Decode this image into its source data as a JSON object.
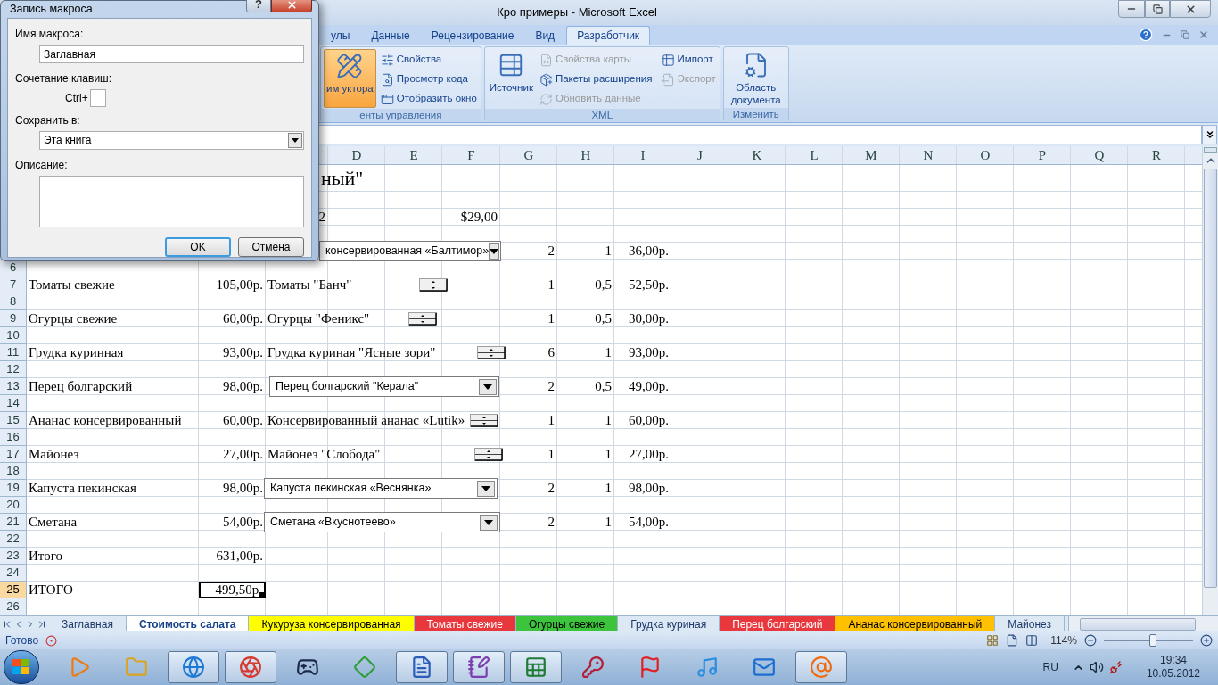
{
  "window": {
    "title": "Кро примеры - Microsoft Excel"
  },
  "ribbon_tabs": [
    {
      "label": "улы",
      "selected": false
    },
    {
      "label": "Данные",
      "selected": false
    },
    {
      "label": "Рецензирование",
      "selected": false
    },
    {
      "label": "Вид",
      "selected": false
    },
    {
      "label": "Разработчик",
      "selected": true
    }
  ],
  "ribbon_groups": [
    {
      "label": "енты управления",
      "items": [
        {
          "kind": "large",
          "label": "им уктора",
          "pressed": true,
          "disabled": false
        },
        {
          "kind": "small",
          "label": "Свойства",
          "pressed": false,
          "disabled": false
        },
        {
          "kind": "small",
          "label": "Просмотр кода",
          "pressed": false,
          "disabled": false
        },
        {
          "kind": "small",
          "label": "Отобразить окно",
          "pressed": false,
          "disabled": false
        }
      ]
    },
    {
      "label": "XML",
      "items": [
        {
          "kind": "large",
          "label": "Источник",
          "pressed": false,
          "disabled": false
        },
        {
          "kind": "small",
          "label": "Свойства карты",
          "pressed": false,
          "disabled": true
        },
        {
          "kind": "small",
          "label": "Пакеты расширения",
          "pressed": false,
          "disabled": false
        },
        {
          "kind": "small",
          "label": "Обновить данные",
          "pressed": false,
          "disabled": true
        },
        {
          "kind": "small",
          "label": "Импорт",
          "pressed": false,
          "disabled": false
        },
        {
          "kind": "small",
          "label": "Экспорт",
          "pressed": false,
          "disabled": true
        }
      ]
    },
    {
      "label": "Изменить",
      "items": [
        {
          "kind": "large",
          "label": "Область документа",
          "pressed": false,
          "disabled": false
        }
      ]
    }
  ],
  "sheet": {
    "columns": [
      "D",
      "E",
      "F",
      "G",
      "H",
      "I",
      "J",
      "K",
      "L",
      "M",
      "N",
      "O",
      "P",
      "Q",
      "R"
    ],
    "rows": [
      {
        "title": "ный\""
      },
      {},
      {
        "c": "2",
        "f": "$29,00"
      },
      {},
      {
        "control": {
          "kind": "dropdown",
          "label": "консервированная «Балтимор»"
        },
        "g": "2",
        "h": "1",
        "i": "36,00р."
      },
      {
        "number": "6",
        "selected": false
      },
      {
        "number": "7",
        "a": "Томаты свежие",
        "b": "105,00р.",
        "control": {
          "kind": "spinner",
          "label": "Томаты \"Банч\""
        },
        "g": "1",
        "h": "0,5",
        "i": "52,50р.",
        "selected": false
      },
      {
        "number": "8",
        "selected": false
      },
      {
        "number": "9",
        "a": "Огурцы свежие",
        "b": "60,00р.",
        "control": {
          "kind": "spinner",
          "label": "Огурцы  \"Феникс\""
        },
        "g": "1",
        "h": "0,5",
        "i": "30,00р.",
        "selected": false
      },
      {
        "number": "10",
        "selected": false
      },
      {
        "number": "11",
        "a": "Грудка куринная",
        "b": "93,00р.",
        "control": {
          "kind": "spinner",
          "label": "Грудка куриная \"Ясные зори\""
        },
        "g": "6",
        "h": "1",
        "i": "93,00р.",
        "selected": false
      },
      {
        "number": "12",
        "selected": false
      },
      {
        "number": "13",
        "a": "Перец болгарский",
        "b": "98,00р.",
        "control": {
          "kind": "dropdown",
          "label": "Перец болгарский \"Керала\""
        },
        "g": "2",
        "h": "0,5",
        "i": "49,00р.",
        "selected": false
      },
      {
        "number": "14",
        "selected": false
      },
      {
        "number": "15",
        "a": "Ананас консервированный",
        "b": "60,00р.",
        "control": {
          "kind": "spinner",
          "label": "Консервированный ананас «Lutik»"
        },
        "g": "1",
        "h": "1",
        "i": "60,00р.",
        "selected": false
      },
      {
        "number": "16",
        "selected": false
      },
      {
        "number": "17",
        "a": "Майонез",
        "b": "27,00р.",
        "control": {
          "kind": "spinner",
          "label": "Майонез \"Слобода\""
        },
        "g": "1",
        "h": "1",
        "i": "27,00р.",
        "selected": false
      },
      {
        "number": "18",
        "selected": false
      },
      {
        "number": "19",
        "a": "Капуста пекинская",
        "b": "98,00р.",
        "control": {
          "kind": "dropdown",
          "label": "Капуста пекинская «Веснянка»"
        },
        "g": "2",
        "h": "1",
        "i": "98,00р.",
        "selected": false
      },
      {
        "number": "20",
        "selected": false
      },
      {
        "number": "21",
        "a": "Сметана",
        "b": "54,00р.",
        "control": {
          "kind": "dropdown",
          "label": "Сметана «Вкуснотеево»"
        },
        "g": "2",
        "h": "1",
        "i": "54,00р.",
        "selected": false
      },
      {
        "number": "22",
        "selected": false
      },
      {
        "number": "23",
        "a": "Итого",
        "b": "631,00р.",
        "selected": false
      },
      {
        "number": "24",
        "selected": false
      },
      {
        "number": "25",
        "a": "ИТОГО",
        "b": "499,50р.",
        "selected": true
      },
      {
        "number": "26",
        "selected": false
      }
    ]
  },
  "sheet_tabs": [
    {
      "label": "Заглавная",
      "selected": false
    },
    {
      "label": "Стоимость салата",
      "selected": true
    },
    {
      "label": "Кукуруза консервированная",
      "selected": false,
      "color": "#ffff00"
    },
    {
      "label": "Томаты свежие",
      "selected": false,
      "color": "#e8383d"
    },
    {
      "label": "Огурцы свежие",
      "selected": false,
      "color": "#3cc43c"
    },
    {
      "label": "Грудка куриная",
      "selected": false
    },
    {
      "label": "Перец болгарский",
      "selected": false,
      "color": "#e8383d"
    },
    {
      "label": "Ананас консервированный",
      "selected": false,
      "color": "#ffc000"
    },
    {
      "label": "Майонез",
      "selected": false
    }
  ],
  "status_bar": {
    "text": "Готово",
    "zoom": "114%",
    "zoom_slider": {
      "level": 0.55
    }
  },
  "dialog": {
    "title": "Запись макроса",
    "help_button": "?",
    "name_label": "Имя макроса:",
    "name_value": "Заглавная",
    "shortcut_label": "Сочетание клавиш:",
    "shortcut_prefix": "Ctrl+",
    "store_label": "Сохранить в:",
    "store_value": "Эта книга",
    "description_label": "Описание:",
    "buttons": [
      {
        "label": "OK",
        "default": true
      },
      {
        "label": "Отмена",
        "default": false
      }
    ]
  },
  "taskbar": {
    "apps": [
      {
        "running": false
      },
      {
        "running": false
      },
      {
        "running": true
      },
      {
        "running": true
      },
      {
        "running": false
      },
      {
        "running": false
      },
      {
        "running": true
      },
      {
        "running": true
      },
      {
        "running": true
      },
      {
        "running": false
      },
      {
        "running": false
      },
      {
        "running": false
      },
      {
        "running": false
      },
      {
        "running": true
      }
    ],
    "language": "RU",
    "time": "19:34",
    "date": "10.05.2012"
  }
}
